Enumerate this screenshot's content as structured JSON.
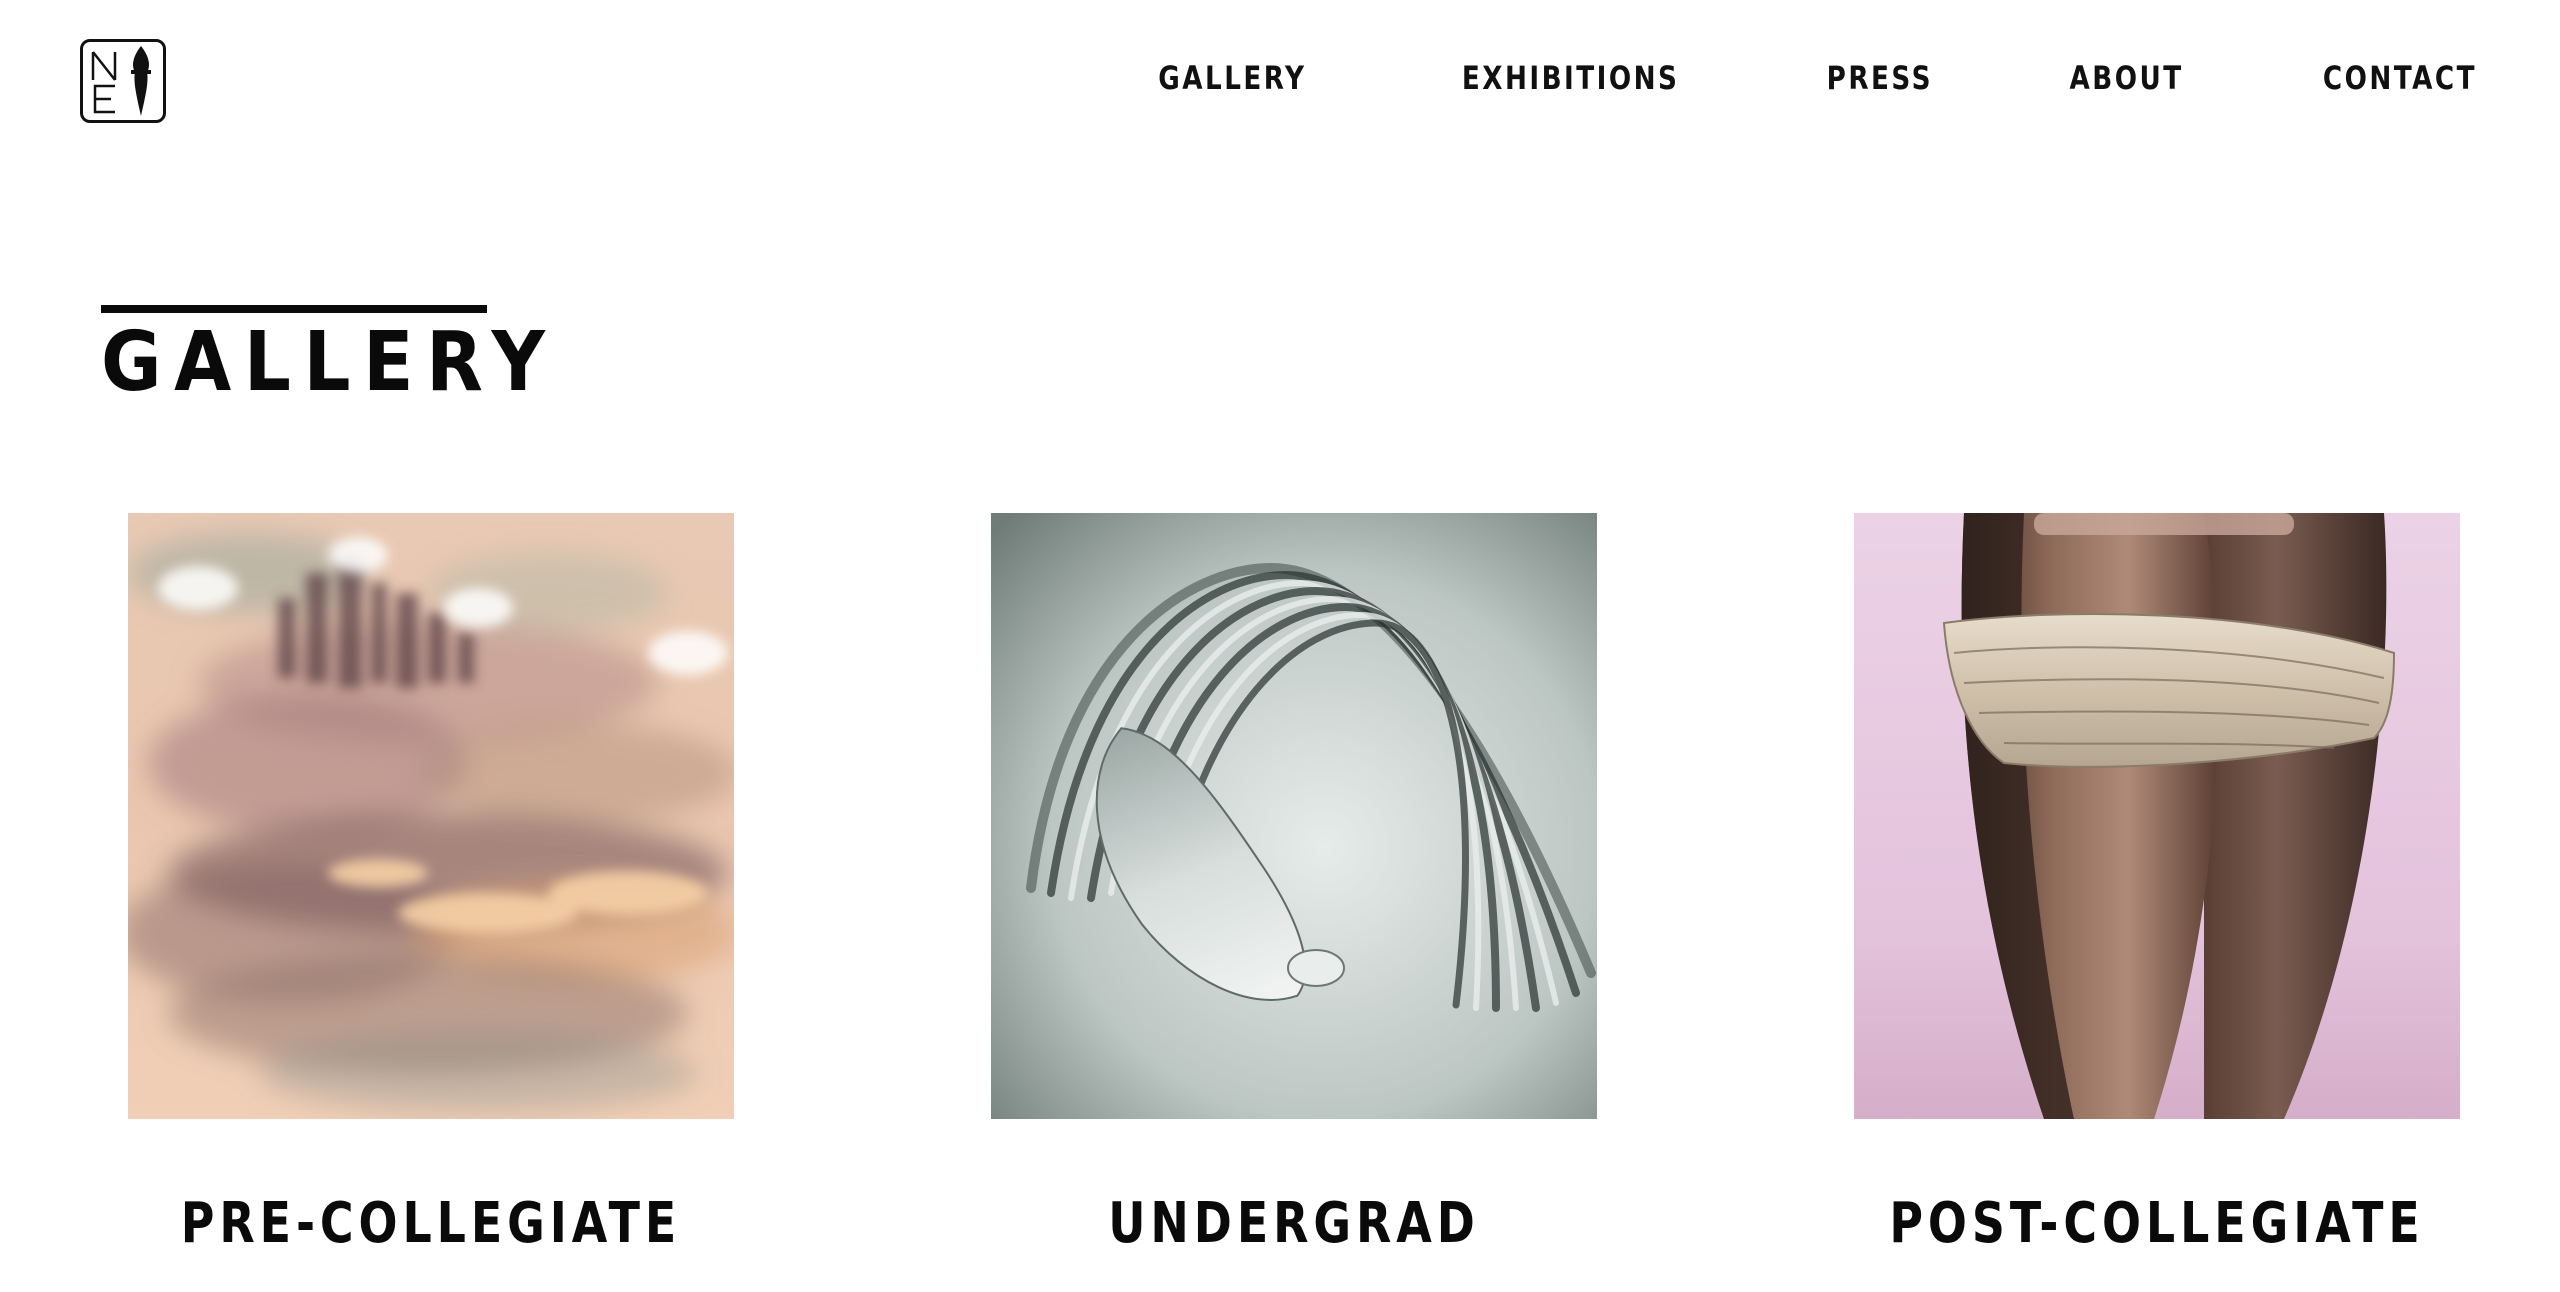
{
  "header": {
    "logo_letters": "NE",
    "nav": [
      {
        "label": "GALLERY",
        "icon": ""
      },
      {
        "label": "EXHIBITIONS",
        "icon": ""
      },
      {
        "label": "PRESS",
        "icon": ""
      },
      {
        "label": "ABOUT",
        "icon": ""
      },
      {
        "label": "CONTACT",
        "icon": ""
      }
    ]
  },
  "main": {
    "title": "GALLERY",
    "cards": [
      {
        "label": "PRE-COLLEGIATE",
        "image": "watercolor-cityscape-artwork"
      },
      {
        "label": "UNDERGRAD",
        "image": "glass-arch-sculpture"
      },
      {
        "label": "POST-COLLEGIATE",
        "image": "wrapped-pod-sculpture"
      }
    ]
  },
  "colors": {
    "text": "#0a0a0a",
    "background": "#ffffff"
  }
}
